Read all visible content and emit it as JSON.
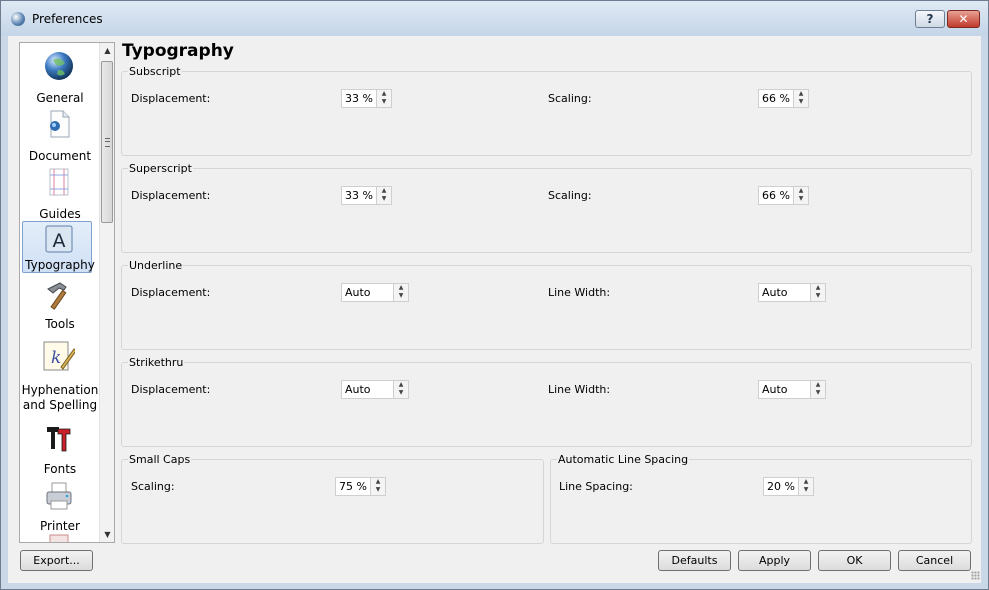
{
  "window": {
    "title": "Preferences",
    "help_label": "?",
    "close_label": "✕"
  },
  "sidebar": {
    "items": [
      {
        "label": "General",
        "icon": "globe-icon"
      },
      {
        "label": "Document",
        "icon": "document-icon"
      },
      {
        "label": "Guides",
        "icon": "guides-icon"
      },
      {
        "label": "Typography",
        "icon": "typography-icon",
        "selected": true
      },
      {
        "label": "Tools",
        "icon": "hammer-icon"
      },
      {
        "label": "Hyphenation and Spelling",
        "icon": "spelling-icon"
      },
      {
        "label": "Fonts",
        "icon": "fonts-icon"
      },
      {
        "label": "Printer",
        "icon": "printer-icon"
      }
    ]
  },
  "page": {
    "title": "Typography"
  },
  "subscript": {
    "title": "Subscript",
    "displacement_label": "Displacement:",
    "displacement_value": "33 %",
    "scaling_label": "Scaling:",
    "scaling_value": "66 %"
  },
  "superscript": {
    "title": "Superscript",
    "displacement_label": "Displacement:",
    "displacement_value": "33 %",
    "scaling_label": "Scaling:",
    "scaling_value": "66 %"
  },
  "underline": {
    "title": "Underline",
    "displacement_label": "Displacement:",
    "displacement_value": "Auto",
    "linewidth_label": "Line Width:",
    "linewidth_value": "Auto"
  },
  "strikethru": {
    "title": "Strikethru",
    "displacement_label": "Displacement:",
    "displacement_value": "Auto",
    "linewidth_label": "Line Width:",
    "linewidth_value": "Auto"
  },
  "smallcaps": {
    "title": "Small Caps",
    "scaling_label": "Scaling:",
    "scaling_value": "75 %"
  },
  "autospacing": {
    "title": "Automatic Line Spacing",
    "linespacing_label": "Line Spacing:",
    "linespacing_value": "20 %"
  },
  "footer": {
    "export_label": "Export...",
    "defaults_label": "Defaults",
    "apply_label": "Apply",
    "ok_label": "OK",
    "cancel_label": "Cancel"
  },
  "colors": {
    "selection": "#cfe0f5",
    "panel": "#f0f0f0",
    "close_button": "#c0392b"
  }
}
